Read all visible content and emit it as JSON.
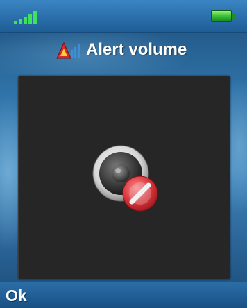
{
  "status_bar": {
    "signal_icon": "signal-strength-icon",
    "battery_icon": "battery-full-icon",
    "signal_color": "#3fe35a",
    "battery_color": "#3cc63c"
  },
  "header": {
    "title": "Alert volume",
    "title_icon": "alert-volume-icon"
  },
  "content": {
    "state_icon": "speaker-muted-icon",
    "panel_color": "#262626",
    "prohibit_color": "#d8343a"
  },
  "softkeys": {
    "left": "Ok"
  }
}
